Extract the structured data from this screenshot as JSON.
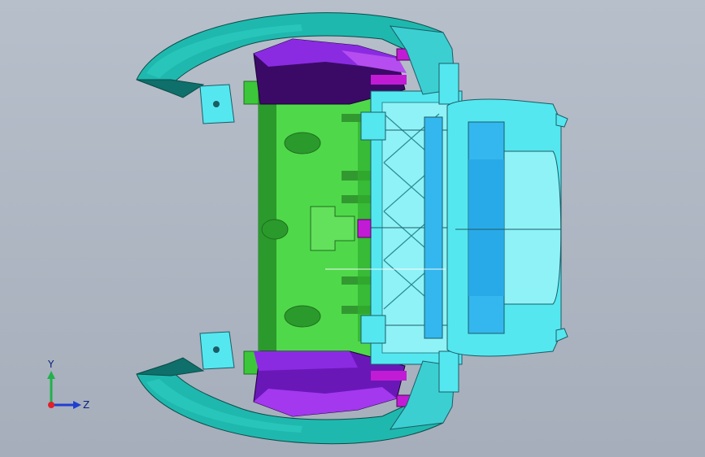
{
  "viewport": {
    "model_colors": {
      "shell": "#1fb8ae",
      "shell_dark": "#0f6f6a",
      "cyan": "#55e7ef",
      "cyan_light": "#8ff2f6",
      "blue": "#33b7ee",
      "green": "#4fd94a",
      "green_dark": "#2b9a2c",
      "purple": "#8a2be2",
      "purple_dark": "#3b0a66",
      "magenta": "#c21bd6"
    }
  },
  "triad": {
    "y_label": "Y",
    "z_label": "Z",
    "y_color": "#22b14c",
    "z_color": "#1f3fd1",
    "origin_color": "#e0202b"
  }
}
